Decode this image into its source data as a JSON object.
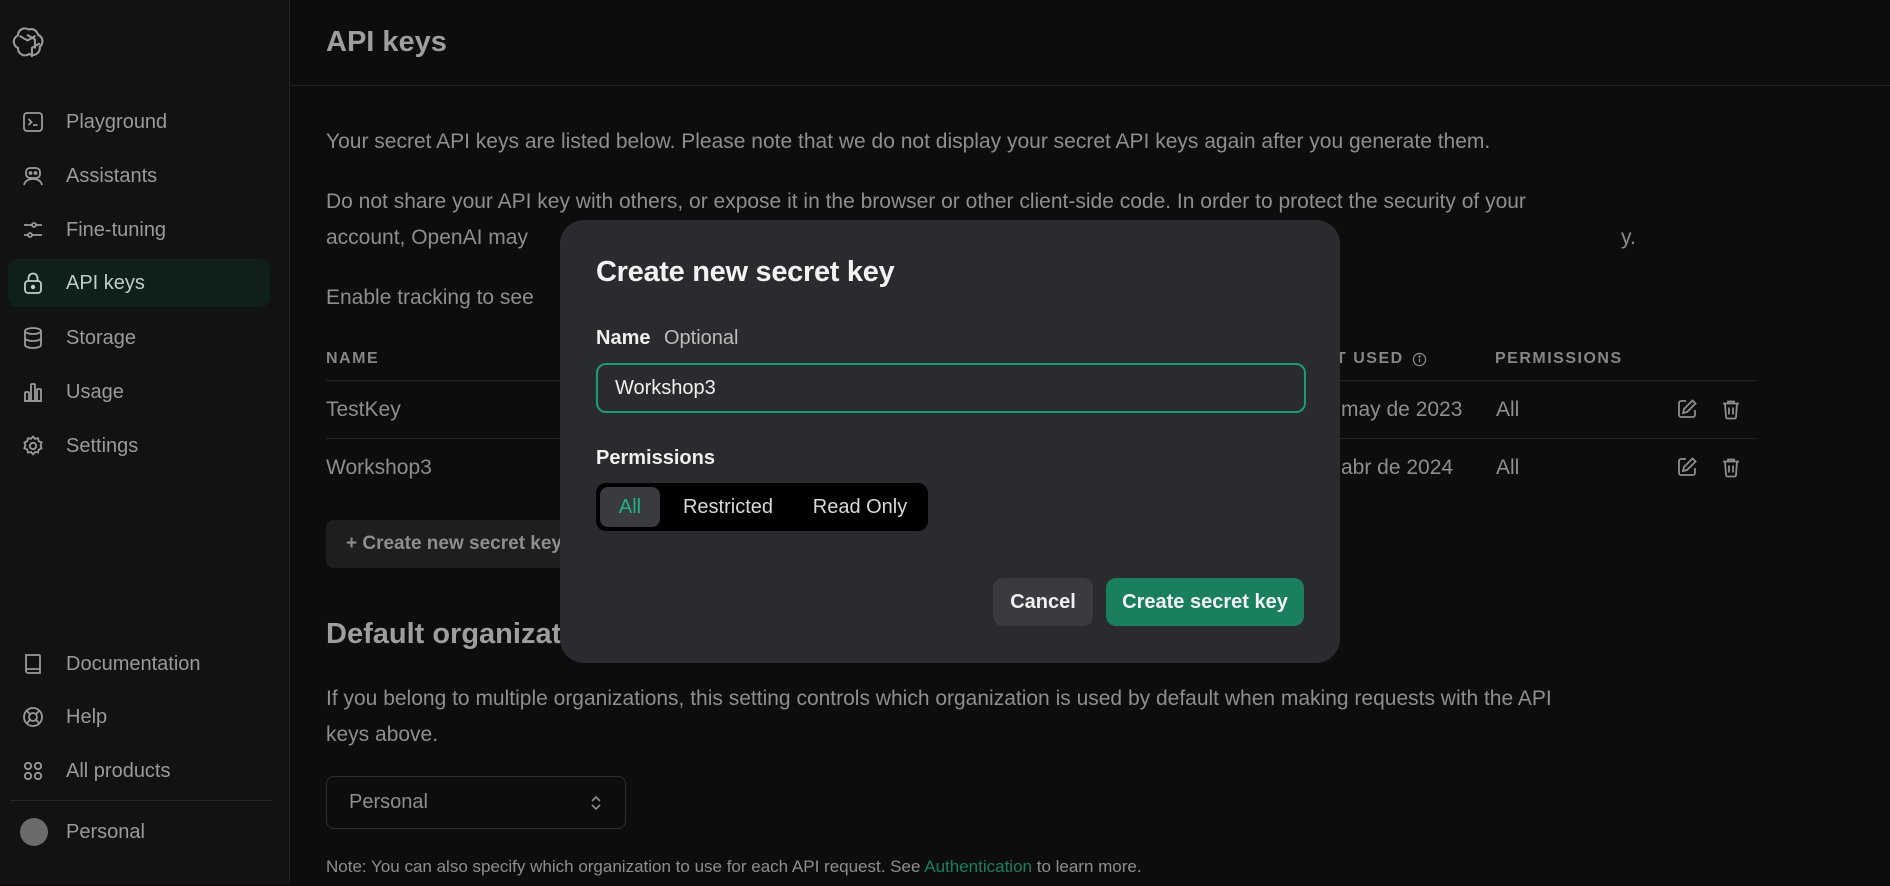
{
  "sidebar": {
    "logo": "openai-logo",
    "items": [
      {
        "label": "Playground",
        "icon": "terminal-icon"
      },
      {
        "label": "Assistants",
        "icon": "robot-icon"
      },
      {
        "label": "Fine-tuning",
        "icon": "sliders-icon"
      },
      {
        "label": "API keys",
        "icon": "lock-icon",
        "active": true
      },
      {
        "label": "Storage",
        "icon": "database-icon"
      },
      {
        "label": "Usage",
        "icon": "bar-chart-icon"
      },
      {
        "label": "Settings",
        "icon": "gear-icon"
      }
    ],
    "bottom_items": [
      {
        "label": "Documentation",
        "icon": "book-icon"
      },
      {
        "label": "Help",
        "icon": "lifebuoy-icon"
      },
      {
        "label": "All products",
        "icon": "grid-icon"
      }
    ],
    "account": {
      "label": "Personal"
    }
  },
  "main": {
    "title": "API keys",
    "para1": "Your secret API keys are listed below. Please note that we do not display your secret API keys again after you generate them.",
    "para2_line1": "Do not share your API key with others, or expose it in the browser or other client-side code. In order to protect the security of your",
    "para2_line2_start": "account, OpenAI may",
    "para2_line2_end": "y.",
    "para3": "Enable tracking to see",
    "table": {
      "headers": {
        "name": "NAME",
        "last_used": "T USED",
        "permissions": "PERMISSIONS"
      },
      "rows": [
        {
          "name": "TestKey",
          "last_used": "may de 2023",
          "permissions": "All"
        },
        {
          "name": "Workshop3",
          "last_used": "abr de 2024",
          "permissions": "All"
        }
      ]
    },
    "create_button": "+ Create new secret key",
    "default_org_title": "Default organizat",
    "default_org_desc_line1": "If you belong to multiple organizations, this setting controls which organization is used by default when making requests with the API",
    "default_org_desc_line2": "keys above.",
    "org_select": "Personal",
    "note_prefix": "Note: You can also specify which organization to use for each API request. See",
    "note_link": "Authentication",
    "note_suffix": "to learn more."
  },
  "modal": {
    "title": "Create new secret key",
    "name_label": "Name",
    "name_optional": "Optional",
    "name_value": "Workshop3",
    "permissions_label": "Permissions",
    "permission_options": [
      "All",
      "Restricted",
      "Read Only"
    ],
    "permission_selected": "All",
    "cancel_label": "Cancel",
    "create_label": "Create secret key"
  },
  "colors": {
    "accent": "#1a7f5e",
    "accent_bright": "#1fb284",
    "modal_bg": "#2a2b2f",
    "page_bg": "#0d0d0d"
  }
}
